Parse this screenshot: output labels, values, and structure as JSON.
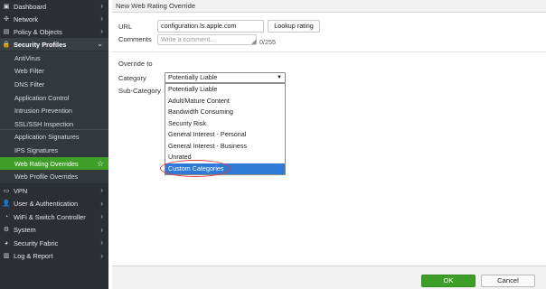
{
  "sidebar": {
    "top_items": [
      {
        "label": "Dashboard",
        "icon": "dashboard-icon",
        "glyph": "▣"
      },
      {
        "label": "Network",
        "icon": "network-icon",
        "glyph": "✣"
      },
      {
        "label": "Policy & Objects",
        "icon": "policy-icon",
        "glyph": "▤"
      },
      {
        "label": "Security Profiles",
        "icon": "lock-icon",
        "glyph": "🔒"
      }
    ],
    "security_profiles_sub": [
      "AntiVirus",
      "Web Filter",
      "DNS Filter",
      "Application Control",
      "Intrusion Prevention",
      "SSL/SSH Inspection",
      "Application Signatures",
      "IPS Signatures",
      "Web Rating Overrides",
      "Web Profile Overrides"
    ],
    "active_sub": "Web Rating Overrides",
    "bottom_items": [
      {
        "label": "VPN",
        "icon": "vpn-icon",
        "glyph": "▭"
      },
      {
        "label": "User & Authentication",
        "icon": "user-icon",
        "glyph": "👤"
      },
      {
        "label": "WiFi & Switch Controller",
        "icon": "wifi-icon",
        "glyph": "◔"
      },
      {
        "label": "System",
        "icon": "gear-icon",
        "glyph": "⚙"
      },
      {
        "label": "Security Fabric",
        "icon": "fabric-icon",
        "glyph": "◕"
      },
      {
        "label": "Log & Report",
        "icon": "report-icon",
        "glyph": "▥"
      }
    ],
    "colors": {
      "background": "#2b2f33",
      "active": "#3e9e27"
    }
  },
  "dialog": {
    "title": "New Web Rating Override",
    "url_label": "URL",
    "url_value": "configuration.ls.apple.com",
    "lookup_button": "Lookup rating",
    "comments_label": "Comments",
    "comments_placeholder": "Write a comment...",
    "comments_count": "0/255",
    "override_section": "Override to",
    "category_label": "Category",
    "category_selected": "Potentially Liable",
    "subcategory_label": "Sub-Category",
    "category_options": [
      "Potentially Liable",
      "Adult/Mature Content",
      "Bandwidth Consuming",
      "Security Risk",
      "General Interest - Personal",
      "General Interest - Business",
      "Unrated",
      "Custom Categories"
    ],
    "highlighted_option": "Custom Categories",
    "ok_button": "OK",
    "cancel_button": "Cancel"
  },
  "colors": {
    "ok_button": "#3e9e27",
    "dropdown_highlight": "#2f7ad6",
    "annotation_ring": "#e23b3b"
  }
}
